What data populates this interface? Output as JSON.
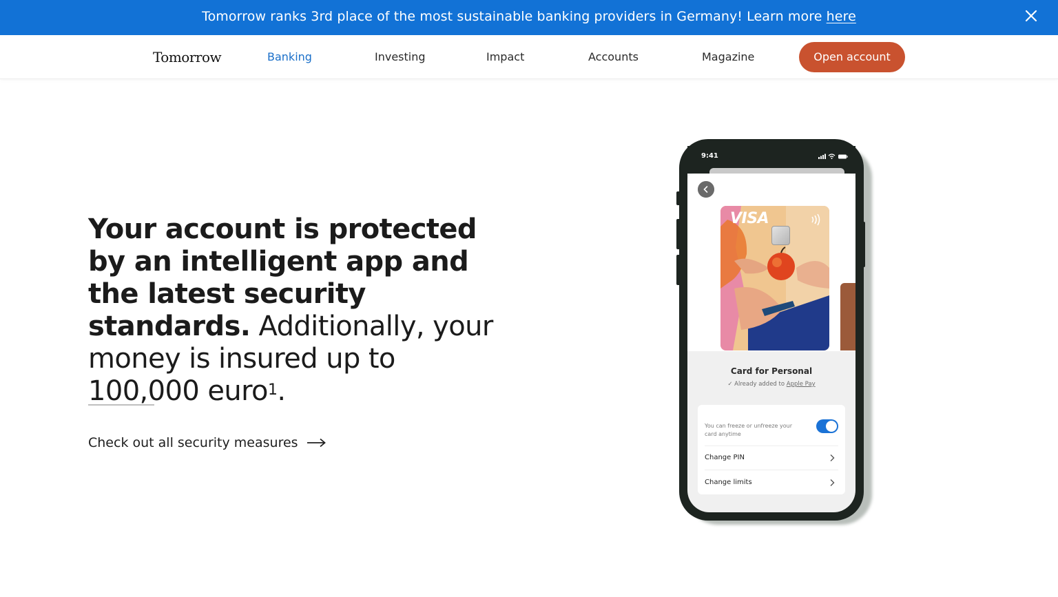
{
  "banner": {
    "text": "Tomorrow ranks 3rd place of the most sustainable banking providers in Germany! Learn more ",
    "link": "here",
    "bg_color": "#1272d6"
  },
  "nav": {
    "logo": "Tomorrow",
    "items": [
      {
        "label": "Banking",
        "active": true
      },
      {
        "label": "Investing",
        "active": false
      },
      {
        "label": "Impact",
        "active": false
      },
      {
        "label": "Accounts",
        "active": false
      },
      {
        "label": "Magazine",
        "active": false
      }
    ],
    "cta": "Open account",
    "cta_color": "#c9522f",
    "active_color": "#1a6fc9"
  },
  "hero": {
    "headline_bold": "Your account is protected by an intelligent app and the latest security standards.",
    "headline_regular": " Additionally, your money is insured up to 100,000 euro",
    "footnote": "1",
    "headline_end": ".",
    "link": "Check out all security measures"
  },
  "phone": {
    "time": "9:41",
    "card_brand": "VISA",
    "card_title": "Card for Personal",
    "card_subtitle_prefix": "Already added to ",
    "card_subtitle_link": "Apple Pay",
    "freeze_text": "You can freeze or unfreeze your card anytime",
    "freeze_enabled": true,
    "rows": [
      {
        "label": "Change PIN"
      },
      {
        "label": "Change limits"
      }
    ]
  }
}
